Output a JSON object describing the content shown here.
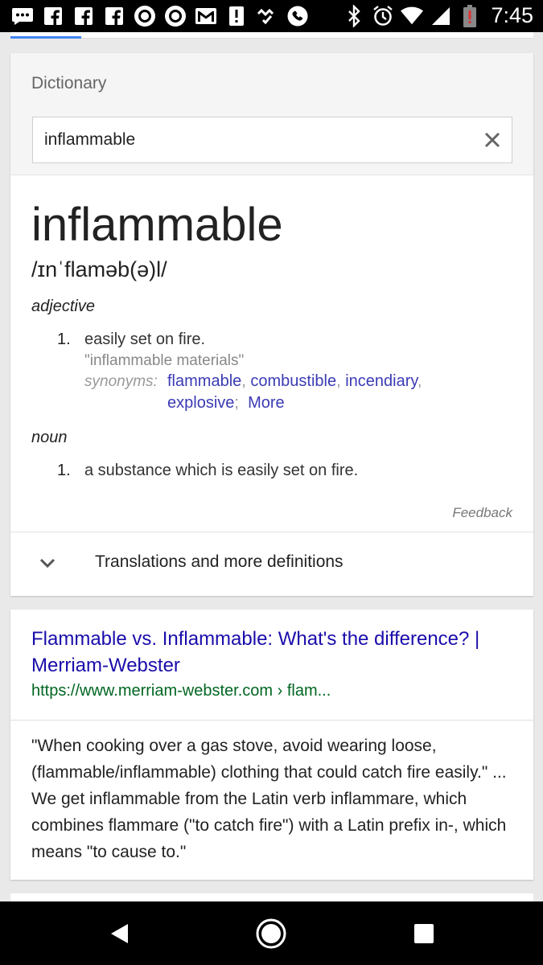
{
  "status_bar": {
    "time": "7:45",
    "left_icons": [
      "message-icon",
      "facebook-icon",
      "facebook-icon",
      "facebook-icon",
      "circle-app-icon",
      "circle-app-icon",
      "gmail-icon",
      "alert-icon",
      "check-icon",
      "phone-icon"
    ],
    "right_icons": [
      "bluetooth-icon",
      "alarm-icon",
      "wifi-icon",
      "signal-icon",
      "battery-low-icon"
    ]
  },
  "dictionary": {
    "label": "Dictionary",
    "search_value": "inflammable",
    "headword": "inflammable",
    "phonetic": "/ɪnˈflaməb(ə)l/",
    "senses": [
      {
        "pos": "adjective",
        "number": "1.",
        "definition": "easily set on fire.",
        "example": "\"inflammable materials\"",
        "synonyms_label": "synonyms:",
        "synonyms": [
          "flammable",
          "combustible",
          "incendiary",
          "explosive"
        ],
        "more": "More"
      },
      {
        "pos": "noun",
        "number": "1.",
        "definition": "a substance which is easily set on fire."
      }
    ],
    "feedback": "Feedback",
    "more_definitions": "Translations and more definitions"
  },
  "result": {
    "title": "Flammable vs. Inflammable: What's the difference? | Merriam-Webster",
    "url": "https://www.merriam-webster.com › flam...",
    "snippet": "\"When cooking over a gas stove, avoid wearing loose, (flammable/inflammable) clothing that could catch fire easily.\" ... We get inflammable from the Latin verb inflammare, which combines flammare (\"to catch fire\") with a Latin prefix in-, which means \"to cause to.\""
  },
  "colors": {
    "link": "#1a0dab",
    "synonym_link": "#3b3bb5",
    "url_green": "#006621",
    "tab_indicator": "#4285f4"
  }
}
